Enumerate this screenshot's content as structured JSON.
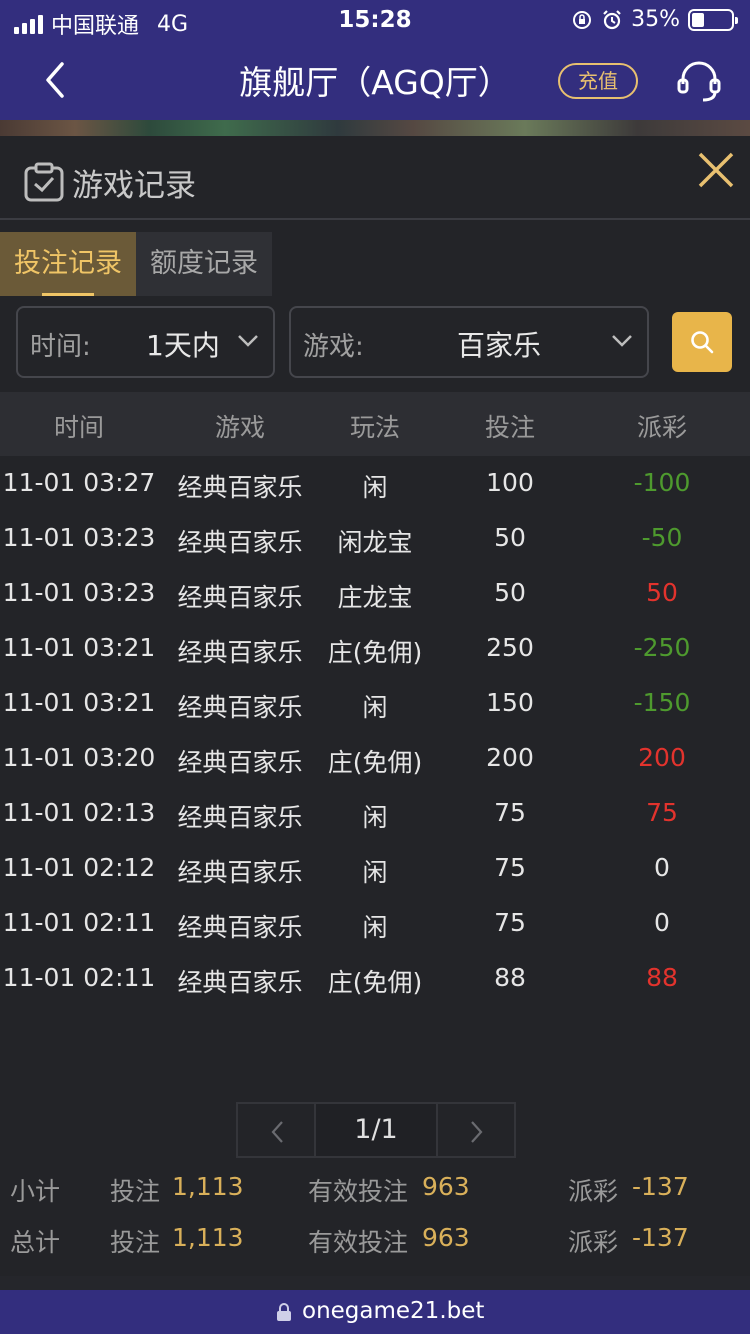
{
  "status_bar": {
    "carrier": "中国联通",
    "network": "4G",
    "time": "15:28",
    "battery": "35%"
  },
  "nav": {
    "title": "旗舰厅（AGQ厅）",
    "recharge": "充值"
  },
  "panel": {
    "title": "游戏记录",
    "tabs": [
      {
        "label": "投注记录",
        "active": true
      },
      {
        "label": "额度记录",
        "active": false
      }
    ],
    "filters": {
      "time_label": "时间:",
      "time_value": "1天内",
      "game_label": "游戏:",
      "game_value": "百家乐"
    },
    "table": {
      "headers": [
        "时间",
        "游戏",
        "玩法",
        "投注",
        "派彩"
      ],
      "rows": [
        {
          "time": "11-01 03:27",
          "game": "经典百家乐",
          "play": "闲",
          "bet": "100",
          "payout": "-100",
          "sign": "neg"
        },
        {
          "time": "11-01 03:23",
          "game": "经典百家乐",
          "play": "闲龙宝",
          "bet": "50",
          "payout": "-50",
          "sign": "neg"
        },
        {
          "time": "11-01 03:23",
          "game": "经典百家乐",
          "play": "庄龙宝",
          "bet": "50",
          "payout": "50",
          "sign": "pos"
        },
        {
          "time": "11-01 03:21",
          "game": "经典百家乐",
          "play": "庄(免佣)",
          "bet": "250",
          "payout": "-250",
          "sign": "neg"
        },
        {
          "time": "11-01 03:21",
          "game": "经典百家乐",
          "play": "闲",
          "bet": "150",
          "payout": "-150",
          "sign": "neg"
        },
        {
          "time": "11-01 03:20",
          "game": "经典百家乐",
          "play": "庄(免佣)",
          "bet": "200",
          "payout": "200",
          "sign": "pos"
        },
        {
          "time": "11-01 02:13",
          "game": "经典百家乐",
          "play": "闲",
          "bet": "75",
          "payout": "75",
          "sign": "pos"
        },
        {
          "time": "11-01 02:12",
          "game": "经典百家乐",
          "play": "闲",
          "bet": "75",
          "payout": "0",
          "sign": "zero"
        },
        {
          "time": "11-01 02:11",
          "game": "经典百家乐",
          "play": "闲",
          "bet": "75",
          "payout": "0",
          "sign": "zero"
        },
        {
          "time": "11-01 02:11",
          "game": "经典百家乐",
          "play": "庄(免佣)",
          "bet": "88",
          "payout": "88",
          "sign": "pos"
        }
      ]
    },
    "pagination": {
      "page": "1/1"
    },
    "subtotal": {
      "label": "小计",
      "bet_label": "投注",
      "bet": "1,113",
      "valid_label": "有效投注",
      "valid": "963",
      "payout_label": "派彩",
      "payout": "-137"
    },
    "total": {
      "label": "总计",
      "bet_label": "投注",
      "bet": "1,113",
      "valid_label": "有效投注",
      "valid": "963",
      "payout_label": "派彩",
      "payout": "-137"
    }
  },
  "url_bar": {
    "domain": "onegame21.bet"
  },
  "colors": {
    "brand_bar": "#332e7e",
    "gold": "#e8b54a",
    "loss": "#4e9a2e",
    "win": "#e2332d"
  }
}
